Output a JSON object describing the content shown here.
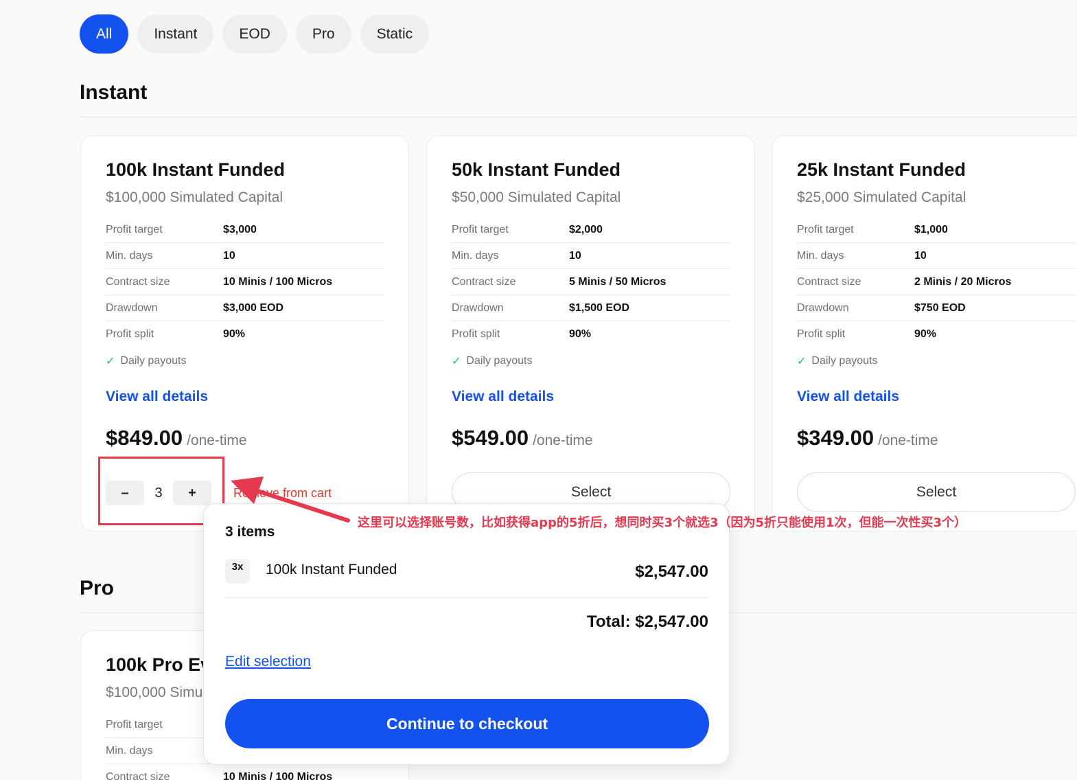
{
  "filters": [
    {
      "label": "All",
      "active": true
    },
    {
      "label": "Instant",
      "active": false
    },
    {
      "label": "EOD",
      "active": false
    },
    {
      "label": "Pro",
      "active": false
    },
    {
      "label": "Static",
      "active": false
    }
  ],
  "sections": {
    "instant": "Instant",
    "pro": "Pro"
  },
  "spec_labels": {
    "profit_target": "Profit target",
    "min_days": "Min. days",
    "contract_size": "Contract size",
    "drawdown": "Drawdown",
    "profit_split": "Profit split"
  },
  "cards": [
    {
      "title": "100k Instant Funded",
      "subtitle": "$100,000 Simulated Capital",
      "profit_target": "$3,000",
      "min_days": "10",
      "contract_size": "10 Minis / 100 Micros",
      "drawdown": "$3,000 EOD",
      "profit_split": "90%",
      "feature": "Daily payouts",
      "details_link": "View all details",
      "price": "$849.00",
      "price_unit": "/one-time",
      "quantity": "3",
      "minus": "–",
      "plus": "+",
      "remove_label": "Remove from cart"
    },
    {
      "title": "50k Instant Funded",
      "subtitle": "$50,000 Simulated Capital",
      "profit_target": "$2,000",
      "min_days": "10",
      "contract_size": "5 Minis / 50 Micros",
      "drawdown": "$1,500 EOD",
      "profit_split": "90%",
      "feature": "Daily payouts",
      "details_link": "View all details",
      "price": "$549.00",
      "price_unit": "/one-time",
      "select_label": "Select"
    },
    {
      "title": "25k Instant Funded",
      "subtitle": "$25,000 Simulated Capital",
      "profit_target": "$1,000",
      "min_days": "10",
      "contract_size": "2 Minis / 20 Micros",
      "drawdown": "$750 EOD",
      "profit_split": "90%",
      "feature": "Daily payouts",
      "details_link": "View all details",
      "price": "$349.00",
      "price_unit": "/one-time",
      "select_label": "Select"
    }
  ],
  "pro_card": {
    "title": "100k Pro Ev",
    "subtitle": "$100,000 Simu",
    "contract_size": "10 Minis / 100 Micros"
  },
  "cart": {
    "count": "3 items",
    "qty_badge": "3x",
    "item_name": "100k Instant Funded",
    "item_price": "$2,547.00",
    "total": "Total: $2,547.00",
    "edit_link": "Edit selection",
    "checkout": "Continue to checkout"
  },
  "annotation": {
    "note": "这里可以选择账号数，比如获得app的5折后，想同时买3个就选3（因为5折只能使用1次，但能一次性买3个）",
    "color": "#e53950"
  },
  "colors": {
    "accent": "#1452f0",
    "remove": "#e53935",
    "check": "#2bb673"
  }
}
